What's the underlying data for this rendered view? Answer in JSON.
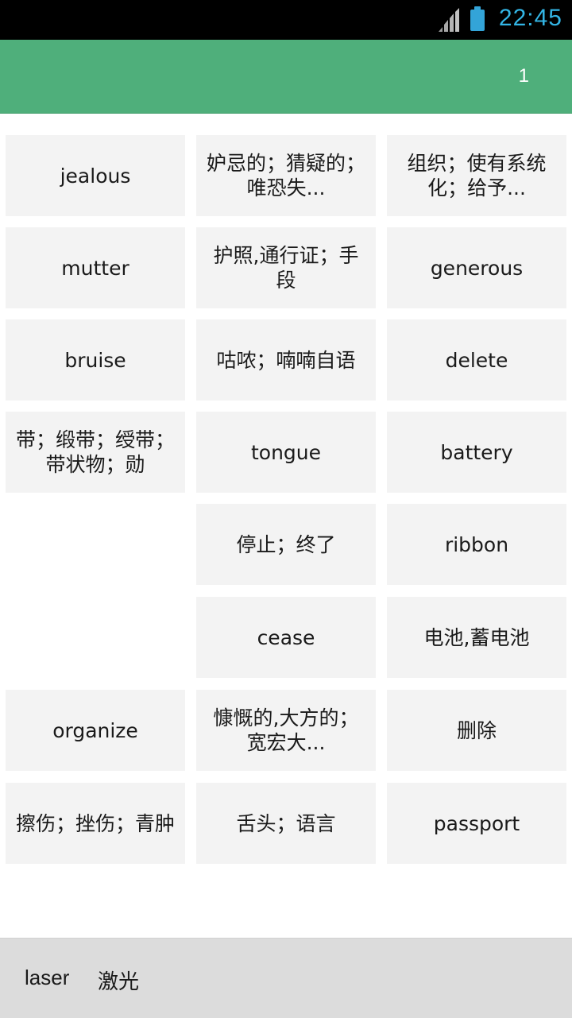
{
  "status_bar": {
    "time": "22:45",
    "signal_icon": "signal-bars-icon",
    "battery_icon": "battery-full-icon",
    "accent_color": "#33b5e5"
  },
  "app_bar": {
    "page_number": "1",
    "color": "#4faf7b"
  },
  "grid": {
    "rows": [
      [
        "jealous",
        "妒忌的；猜疑的；唯恐失...",
        "组织；使有系统化；给予..."
      ],
      [
        "mutter",
        "护照,通行证；手段",
        "generous"
      ],
      [
        "bruise",
        "咕哝；喃喃自语",
        "delete"
      ],
      [
        "带；缎带；绶带；带状物；勋",
        "tongue",
        "battery"
      ],
      [
        null,
        "停止；终了",
        "ribbon"
      ],
      [
        null,
        "cease",
        "电池,蓄电池"
      ],
      [
        "organize",
        "慷慨的,大方的；宽宏大...",
        "删除"
      ],
      [
        "擦伤；挫伤；青肿",
        "舌头；语言",
        "passport"
      ]
    ]
  },
  "bottom_bar": {
    "word": "laser",
    "meaning": "激光"
  }
}
